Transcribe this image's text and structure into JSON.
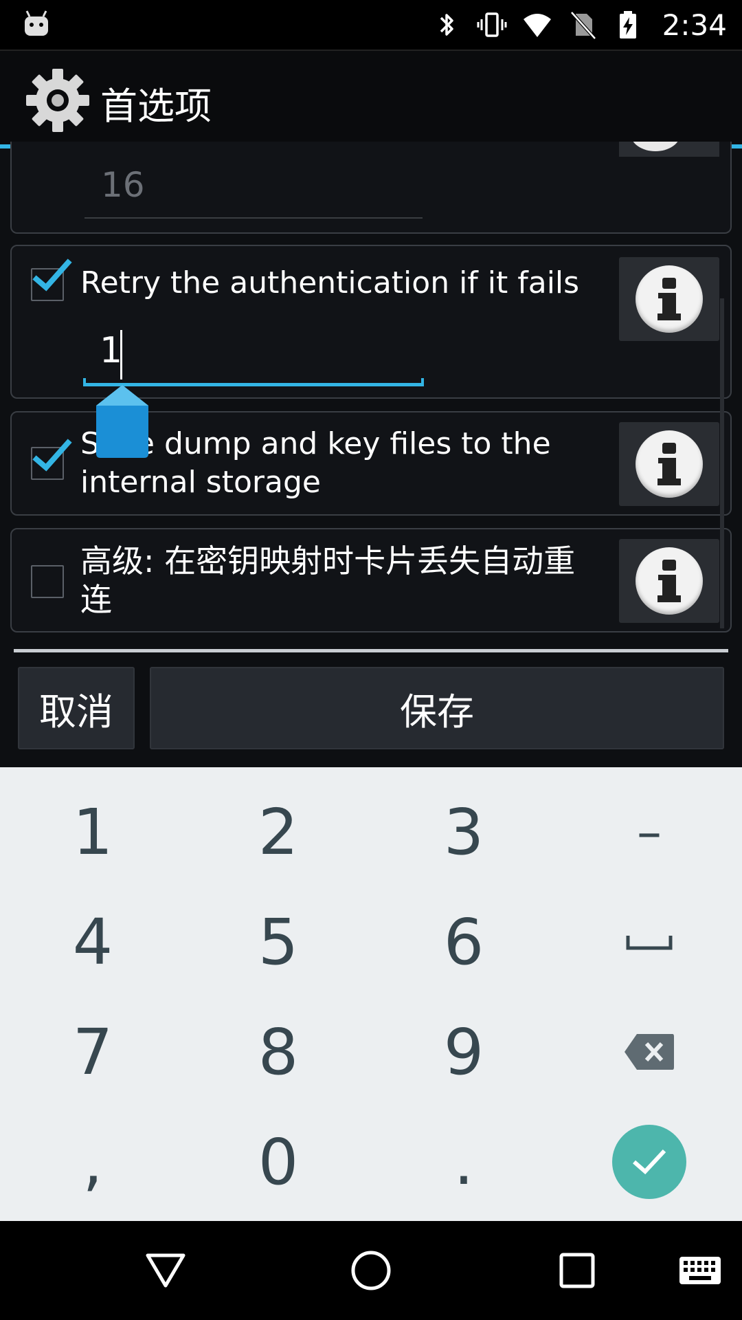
{
  "status_bar": {
    "time": "2:34",
    "icons": [
      "android-debug-icon",
      "bluetooth-icon",
      "vibrate-icon",
      "wifi-icon",
      "no-sim-icon",
      "battery-charging-icon"
    ]
  },
  "action_bar": {
    "title": "首选项",
    "icon": "gear-icon",
    "accent_color": "#33b5e5"
  },
  "preferences": [
    {
      "id": "partial-item",
      "field_value": "16",
      "field_disabled": true
    },
    {
      "id": "retry-auth",
      "checked": true,
      "label": "Retry the authentication if it fails",
      "field_value": "1",
      "field_focused": true
    },
    {
      "id": "save-dump",
      "checked": true,
      "label_line1": "Save dump and key files to the",
      "label_line2": "internal storage"
    },
    {
      "id": "auto-reconnect",
      "checked": false,
      "label_line1": "高级: 在密钥映射时卡片丢失自动重",
      "label_line2": "连"
    }
  ],
  "buttons": {
    "cancel": "取消",
    "save": "保存"
  },
  "keyboard": {
    "rows": [
      [
        "1",
        "2",
        "3",
        "–"
      ],
      [
        "4",
        "5",
        "6",
        "␣"
      ],
      [
        "7",
        "8",
        "9",
        "⌫"
      ],
      [
        ",",
        "0",
        ".",
        "✓"
      ]
    ],
    "done_color": "#4db6ac"
  },
  "nav_bar": [
    "back-icon",
    "home-icon",
    "recents-icon",
    "keyboard-icon"
  ]
}
